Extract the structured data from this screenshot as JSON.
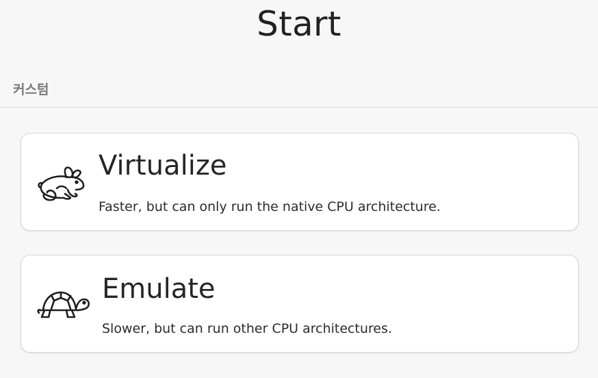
{
  "page": {
    "title": "Start"
  },
  "section": {
    "header": "커스텀"
  },
  "options": [
    {
      "title": "Virtualize",
      "description": "Faster, but can only run the native CPU architecture.",
      "icon": "rabbit-icon"
    },
    {
      "title": "Emulate",
      "description": "Slower, but can run other CPU architectures.",
      "icon": "turtle-icon"
    }
  ]
}
